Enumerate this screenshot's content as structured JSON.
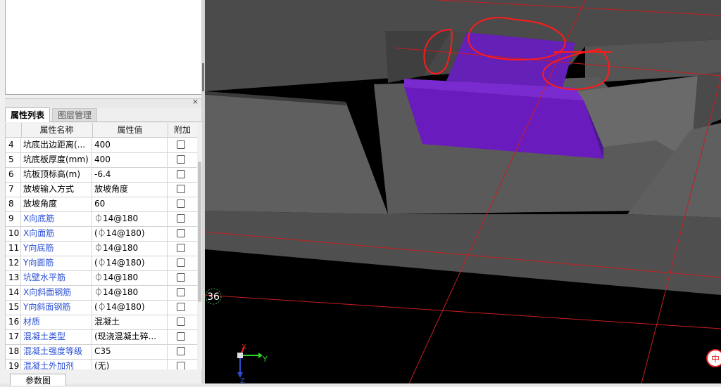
{
  "panel": {
    "tabs": [
      "属性列表",
      "图层管理"
    ],
    "close_glyph": "×",
    "columns": {
      "name": "属性名称",
      "value": "属性值",
      "extra": "附加"
    },
    "rows": [
      {
        "num": "4",
        "name": "坑底出边距离(...",
        "value": "400",
        "blue": false
      },
      {
        "num": "5",
        "name": "坑底板厚度(mm)",
        "value": "400",
        "blue": false
      },
      {
        "num": "6",
        "name": "坑板顶标高(m)",
        "value": "-6.4",
        "blue": false
      },
      {
        "num": "7",
        "name": "放坡输入方式",
        "value": "放坡角度",
        "blue": false
      },
      {
        "num": "8",
        "name": "放坡角度",
        "value": "60",
        "blue": false
      },
      {
        "num": "9",
        "name": "X向底筋",
        "value": "⏀14@180",
        "blue": true
      },
      {
        "num": "10",
        "name": "X向面筋",
        "value": "(⏀14@180)",
        "blue": true
      },
      {
        "num": "11",
        "name": "Y向底筋",
        "value": "⏀14@180",
        "blue": true
      },
      {
        "num": "12",
        "name": "Y向面筋",
        "value": "(⏀14@180)",
        "blue": true
      },
      {
        "num": "13",
        "name": "坑壁水平筋",
        "value": "⏀14@180",
        "blue": true
      },
      {
        "num": "14",
        "name": "X向斜面钢筋",
        "value": "⏀14@180",
        "blue": true
      },
      {
        "num": "15",
        "name": "Y向斜面钢筋",
        "value": "(⏀14@180)",
        "blue": true
      },
      {
        "num": "16",
        "name": "材质",
        "value": "混凝土",
        "blue": true
      },
      {
        "num": "17",
        "name": "混凝土类型",
        "value": "(现浇混凝土碎...",
        "blue": true
      },
      {
        "num": "18",
        "name": "混凝土强度等级",
        "value": "C35",
        "blue": true
      },
      {
        "num": "19",
        "name": "混凝土外加剂",
        "value": "(无)",
        "blue": true
      }
    ],
    "bottom_tab": "参数图"
  },
  "viewport": {
    "axis_label": "36",
    "gizmo_y": "Y",
    "gizmo_x": "X",
    "gizmo_z": "Z",
    "corner_badge": "中",
    "colors": {
      "background": "#000000",
      "surface_top": "#4b4b4b",
      "surface_side": "#5f5f5f",
      "pit_purple": "#6520b8",
      "pit_purple_dark": "#4a1890",
      "grid_line": "#c81e1e",
      "annotation": "#ff1a1a"
    }
  }
}
